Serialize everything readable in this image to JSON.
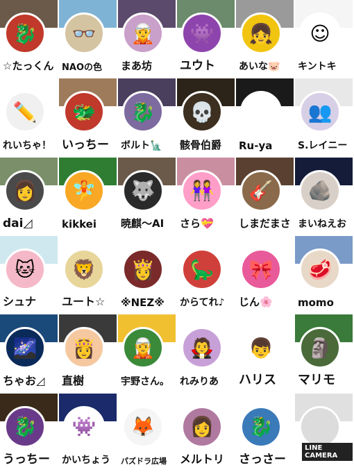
{
  "tiles": [
    {
      "name": "☆たっくん",
      "banner": "#6b5a4a",
      "avatar": "#c0392b",
      "icon": "🐉",
      "size": 15
    },
    {
      "name": "NAOの色",
      "banner": "#7fb3d5",
      "avatar": "#d5c4a1",
      "icon": "👓",
      "size": 13
    },
    {
      "name": "まあ坊",
      "banner": "#5b4a6b",
      "avatar": "#c9a0c9",
      "icon": "🧝",
      "size": 15
    },
    {
      "name": "ユウト",
      "banner": "#6c8a6c",
      "avatar": "#8e44ad",
      "icon": "👾",
      "size": 17
    },
    {
      "name": "あいな🐷",
      "banner": "#9a9a9a",
      "avatar": "#f1c40f",
      "icon": "👧",
      "size": 14
    },
    {
      "name": "キントキ",
      "banner": "#f5f5f5",
      "avatar": "#ffffff",
      "icon": "☺",
      "size": 14
    },
    {
      "name": "れいちゃ！",
      "banner": "#ffffff",
      "avatar": "#f0f0f0",
      "icon": "✏️",
      "size": 14
    },
    {
      "name": "いっちー",
      "banner": "#9e7b5a",
      "avatar": "#c0392b",
      "icon": "🐲",
      "size": 17
    },
    {
      "name": "ボルト🗽",
      "banner": "#4a3f5c",
      "avatar": "#7d6a9e",
      "icon": "🐉",
      "size": 14
    },
    {
      "name": "骸骨伯爵",
      "banner": "#2c2418",
      "avatar": "#3d3020",
      "icon": "💀",
      "size": 15
    },
    {
      "name": "Ru-ya",
      "banner": "#1a1a1a",
      "avatar": "#ffffff",
      "icon": "",
      "size": 15
    },
    {
      "name": "S.レイニー",
      "banner": "#e8e8e8",
      "avatar": "#d6cfe6",
      "icon": "👥",
      "size": 14
    },
    {
      "name": "dai◿",
      "banner": "#7a8f6a",
      "avatar": "#4a4a4a",
      "icon": "👩",
      "size": 17
    },
    {
      "name": "kikkei",
      "banner": "#2e7d32",
      "avatar": "#f9a825",
      "icon": "🧚",
      "size": 15
    },
    {
      "name": "暁麒〜AI",
      "banner": "#6b5a4a",
      "avatar": "#2a2a2a",
      "icon": "🐺",
      "size": 15
    },
    {
      "name": "さら💝",
      "banner": "#c98fa0",
      "avatar": "#ff9ec8",
      "icon": "👭",
      "size": 15
    },
    {
      "name": "しまだまさ",
      "banner": "#5a4030",
      "avatar": "#8a6a4a",
      "icon": "🎸",
      "size": 15
    },
    {
      "name": "まいねえお",
      "banner": "#141c3a",
      "avatar": "#d8d0c8",
      "icon": "🪨",
      "size": 14
    },
    {
      "name": "シュナ",
      "banner": "#cfe8f0",
      "avatar": "#f5b8c8",
      "icon": "🐱",
      "size": 16
    },
    {
      "name": "ユート☆",
      "banner": "#ffffff",
      "avatar": "#e8d59a",
      "icon": "🦁",
      "size": 16
    },
    {
      "name": "※NEZ※",
      "banner": "#ffffff",
      "avatar": "#7a2a2a",
      "icon": "👸",
      "size": 15
    },
    {
      "name": "からてれ♪",
      "banner": "#ffffff",
      "avatar": "#d0403a",
      "icon": "🦕",
      "size": 14
    },
    {
      "name": "じん🌸",
      "banner": "#ffffff",
      "avatar": "#e85a9a",
      "icon": "🎀",
      "size": 15
    },
    {
      "name": "momo",
      "banner": "#7a9bc8",
      "avatar": "#e8d8c8",
      "icon": "🥩",
      "size": 15
    },
    {
      "name": "ちゃお◿",
      "banner": "#1a4a7a",
      "avatar": "#0a2a5a",
      "icon": "🌌",
      "size": 16
    },
    {
      "name": "直樹",
      "banner": "#3a3a3a",
      "avatar": "#f5c8a0",
      "icon": "👸",
      "size": 16
    },
    {
      "name": "宇野さん。",
      "banner": "#f0c030",
      "avatar": "#3a8a3a",
      "icon": "🧝",
      "size": 14
    },
    {
      "name": "れみりあ",
      "banner": "#ffffff",
      "avatar": "#c8a0d8",
      "icon": "🧛",
      "size": 14
    },
    {
      "name": "ハリス",
      "banner": "#ffffff",
      "avatar": "#ffffff",
      "icon": "👦",
      "size": 18
    },
    {
      "name": "マリモ",
      "banner": "#3a7a3a",
      "avatar": "#4a6a3a",
      "icon": "🗿",
      "size": 18
    },
    {
      "name": "うっちー",
      "banner": "#3a2a1a",
      "avatar": "#6a3a8a",
      "icon": "🐉",
      "size": 17
    },
    {
      "name": "かいちょう",
      "banner": "#1a2a6a",
      "avatar": "#ffffff",
      "icon": "👾",
      "size": 14
    },
    {
      "name": "パズドラ広場",
      "banner": "#ffffff",
      "avatar": "#f5f5f5",
      "icon": "🦊",
      "size": 11
    },
    {
      "name": "メルトリ",
      "banner": "#ffffff",
      "avatar": "#b07aa0",
      "icon": "👩",
      "size": 16
    },
    {
      "name": "さっさー",
      "banner": "#ffffff",
      "avatar": "#3a7ab8",
      "icon": "🐉",
      "size": 17
    },
    {
      "name": "",
      "banner": "#e0e0e0",
      "avatar": "#dcdcdc",
      "icon": "",
      "size": 14
    }
  ],
  "last_tile_label": "LINE CAMERA"
}
